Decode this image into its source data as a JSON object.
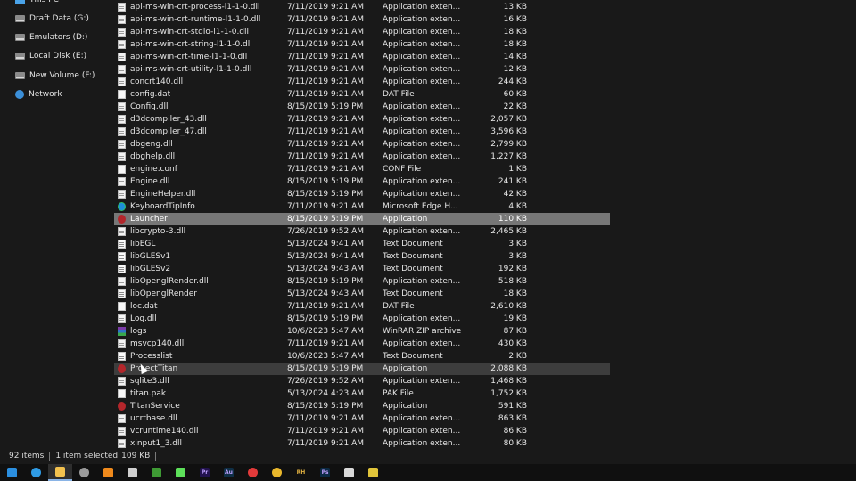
{
  "nav": {
    "items": [
      {
        "label": "This PC",
        "icon": "this-pc-icon"
      },
      {
        "label": "Draft Data (G:)",
        "icon": "drive-icon"
      },
      {
        "label": "Emulators (D:)",
        "icon": "drive-icon"
      },
      {
        "label": "Local Disk (E:)",
        "icon": "drive-icon"
      },
      {
        "label": "New Volume (F:)",
        "icon": "drive-icon"
      },
      {
        "label": "Network",
        "icon": "network-icon"
      }
    ]
  },
  "files": [
    {
      "name": "api-ms-win-crt-process-l1-1-0.dll",
      "date": "7/11/2019 9:21 AM",
      "type": "Application exten...",
      "size": "13 KB",
      "icon": "dll-icon"
    },
    {
      "name": "api-ms-win-crt-runtime-l1-1-0.dll",
      "date": "7/11/2019 9:21 AM",
      "type": "Application exten...",
      "size": "16 KB",
      "icon": "dll-icon"
    },
    {
      "name": "api-ms-win-crt-stdio-l1-1-0.dll",
      "date": "7/11/2019 9:21 AM",
      "type": "Application exten...",
      "size": "18 KB",
      "icon": "dll-icon"
    },
    {
      "name": "api-ms-win-crt-string-l1-1-0.dll",
      "date": "7/11/2019 9:21 AM",
      "type": "Application exten...",
      "size": "18 KB",
      "icon": "dll-icon"
    },
    {
      "name": "api-ms-win-crt-time-l1-1-0.dll",
      "date": "7/11/2019 9:21 AM",
      "type": "Application exten...",
      "size": "14 KB",
      "icon": "dll-icon"
    },
    {
      "name": "api-ms-win-crt-utility-l1-1-0.dll",
      "date": "7/11/2019 9:21 AM",
      "type": "Application exten...",
      "size": "12 KB",
      "icon": "dll-icon"
    },
    {
      "name": "concrt140.dll",
      "date": "7/11/2019 9:21 AM",
      "type": "Application exten...",
      "size": "244 KB",
      "icon": "dll-icon"
    },
    {
      "name": "config.dat",
      "date": "7/11/2019 9:21 AM",
      "type": "DAT File",
      "size": "60 KB",
      "icon": "file-icon"
    },
    {
      "name": "Config.dll",
      "date": "8/15/2019 5:19 PM",
      "type": "Application exten...",
      "size": "22 KB",
      "icon": "dll-icon"
    },
    {
      "name": "d3dcompiler_43.dll",
      "date": "7/11/2019 9:21 AM",
      "type": "Application exten...",
      "size": "2,057 KB",
      "icon": "dll-icon"
    },
    {
      "name": "d3dcompiler_47.dll",
      "date": "7/11/2019 9:21 AM",
      "type": "Application exten...",
      "size": "3,596 KB",
      "icon": "dll-icon"
    },
    {
      "name": "dbgeng.dll",
      "date": "7/11/2019 9:21 AM",
      "type": "Application exten...",
      "size": "2,799 KB",
      "icon": "dll-icon"
    },
    {
      "name": "dbghelp.dll",
      "date": "7/11/2019 9:21 AM",
      "type": "Application exten...",
      "size": "1,227 KB",
      "icon": "dll-icon"
    },
    {
      "name": "engine.conf",
      "date": "7/11/2019 9:21 AM",
      "type": "CONF File",
      "size": "1 KB",
      "icon": "file-icon"
    },
    {
      "name": "Engine.dll",
      "date": "8/15/2019 5:19 PM",
      "type": "Application exten...",
      "size": "241 KB",
      "icon": "dll-icon"
    },
    {
      "name": "EngineHelper.dll",
      "date": "8/15/2019 5:19 PM",
      "type": "Application exten...",
      "size": "42 KB",
      "icon": "dll-icon"
    },
    {
      "name": "KeyboardTipInfo",
      "date": "7/11/2019 9:21 AM",
      "type": "Microsoft Edge H...",
      "size": "4 KB",
      "icon": "edge-icon"
    },
    {
      "name": "Launcher",
      "date": "8/15/2019 5:19 PM",
      "type": "Application",
      "size": "110 KB",
      "icon": "app-icon",
      "state": "sel"
    },
    {
      "name": "libcrypto-3.dll",
      "date": "7/26/2019 9:52 AM",
      "type": "Application exten...",
      "size": "2,465 KB",
      "icon": "dll-icon"
    },
    {
      "name": "libEGL",
      "date": "5/13/2024 9:41 AM",
      "type": "Text Document",
      "size": "3 KB",
      "icon": "doc-icon"
    },
    {
      "name": "libGLESv1",
      "date": "5/13/2024 9:41 AM",
      "type": "Text Document",
      "size": "3 KB",
      "icon": "doc-icon"
    },
    {
      "name": "libGLESv2",
      "date": "5/13/2024 9:43 AM",
      "type": "Text Document",
      "size": "192 KB",
      "icon": "doc-icon"
    },
    {
      "name": "libOpenglRender.dll",
      "date": "8/15/2019 5:19 PM",
      "type": "Application exten...",
      "size": "518 KB",
      "icon": "dll-icon"
    },
    {
      "name": "libOpenglRender",
      "date": "5/13/2024 9:43 AM",
      "type": "Text Document",
      "size": "18 KB",
      "icon": "doc-icon"
    },
    {
      "name": "loc.dat",
      "date": "7/11/2019 9:21 AM",
      "type": "DAT File",
      "size": "2,610 KB",
      "icon": "file-icon"
    },
    {
      "name": "Log.dll",
      "date": "8/15/2019 5:19 PM",
      "type": "Application exten...",
      "size": "19 KB",
      "icon": "dll-icon"
    },
    {
      "name": "logs",
      "date": "10/6/2023 5:47 AM",
      "type": "WinRAR ZIP archive",
      "size": "87 KB",
      "icon": "zip-icon"
    },
    {
      "name": "msvcp140.dll",
      "date": "7/11/2019 9:21 AM",
      "type": "Application exten...",
      "size": "430 KB",
      "icon": "dll-icon"
    },
    {
      "name": "Processlist",
      "date": "10/6/2023 5:47 AM",
      "type": "Text Document",
      "size": "2 KB",
      "icon": "doc-icon"
    },
    {
      "name": "ProjectTitan",
      "date": "8/15/2019 5:19 PM",
      "type": "Application",
      "size": "2,088 KB",
      "icon": "app-icon",
      "state": "hov"
    },
    {
      "name": "sqlite3.dll",
      "date": "7/26/2019 9:52 AM",
      "type": "Application exten...",
      "size": "1,468 KB",
      "icon": "dll-icon"
    },
    {
      "name": "titan.pak",
      "date": "5/13/2024 4:23 AM",
      "type": "PAK File",
      "size": "1,752 KB",
      "icon": "file-icon"
    },
    {
      "name": "TitanService",
      "date": "8/15/2019 5:19 PM",
      "type": "Application",
      "size": "591 KB",
      "icon": "app-icon"
    },
    {
      "name": "ucrtbase.dll",
      "date": "7/11/2019 9:21 AM",
      "type": "Application exten...",
      "size": "863 KB",
      "icon": "dll-icon"
    },
    {
      "name": "vcruntime140.dll",
      "date": "7/11/2019 9:21 AM",
      "type": "Application exten...",
      "size": "86 KB",
      "icon": "dll-icon"
    },
    {
      "name": "xinput1_3.dll",
      "date": "7/11/2019 9:21 AM",
      "type": "Application exten...",
      "size": "80 KB",
      "icon": "dll-icon"
    }
  ],
  "status": {
    "item_count": "92 items",
    "selection": "1 item selected",
    "selection_size": "109 KB"
  },
  "taskbar": {
    "items": [
      {
        "icon": "windows-start-icon",
        "color": "#2b8fe0",
        "text": ""
      },
      {
        "icon": "edge-browser-icon",
        "color": "#2f9be4",
        "text": ""
      },
      {
        "icon": "file-explorer-icon",
        "color": "#f2c14e",
        "text": "",
        "active": true
      },
      {
        "icon": "steam-icon",
        "color": "#9a9a9a",
        "text": ""
      },
      {
        "icon": "vlc-icon",
        "color": "#f08a1c",
        "text": ""
      },
      {
        "icon": "snipping-tool-icon",
        "color": "#cfcfcf",
        "text": ""
      },
      {
        "icon": "nvidia-icon",
        "color": "#3e9a34",
        "text": ""
      },
      {
        "icon": "arrow-app-icon",
        "color": "#5de05a",
        "text": ""
      },
      {
        "icon": "premiere-pro-icon",
        "color": "#22124e",
        "text": "Pr"
      },
      {
        "icon": "audition-icon",
        "color": "#0f2f46",
        "text": "Au"
      },
      {
        "icon": "record-icon",
        "color": "#e23a3a",
        "text": ""
      },
      {
        "icon": "chrome-icon",
        "color": "#e9b72c",
        "text": ""
      },
      {
        "icon": "rh-app-icon",
        "color": "#101010",
        "text": "RH"
      },
      {
        "icon": "photoshop-icon",
        "color": "#0b2a44",
        "text": "Ps"
      },
      {
        "icon": "plane-app-icon",
        "color": "#d9d9d9",
        "text": ""
      },
      {
        "icon": "paint-app-icon",
        "color": "#e0c43a",
        "text": ""
      }
    ]
  }
}
